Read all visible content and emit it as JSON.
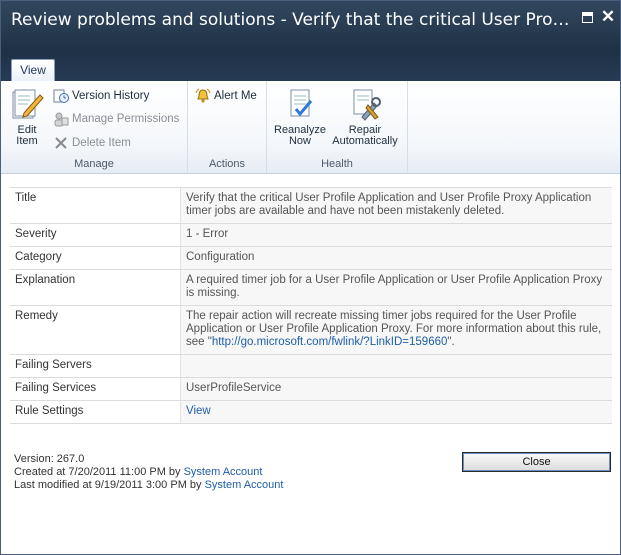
{
  "window": {
    "title": "Review problems and solutions - Verify that the critical User Profile Application and User Profile Proxy Application timer jobs are available and have not been mistakenly deleted."
  },
  "ribbon": {
    "tabs": [
      {
        "label": "View",
        "selected": true
      }
    ],
    "groups": {
      "manage": {
        "label": "Manage",
        "edit_item": "Edit Item",
        "version_history": "Version History",
        "manage_permissions": "Manage Permissions",
        "delete_item": "Delete Item"
      },
      "actions": {
        "label": "Actions",
        "alert_me": "Alert Me"
      },
      "health": {
        "label": "Health",
        "reanalyze_now": "Reanalyze Now",
        "repair_automatically": "Repair Automatically"
      }
    }
  },
  "properties": {
    "title": {
      "label": "Title",
      "value": "Verify that the critical User Profile Application and User Profile Proxy Application timer jobs are available and have not been mistakenly deleted."
    },
    "severity": {
      "label": "Severity",
      "value": "1 - Error"
    },
    "category": {
      "label": "Category",
      "value": "Configuration"
    },
    "explanation": {
      "label": "Explanation",
      "value": "A required timer job for a User Profile Application or User Profile Application Proxy is missing."
    },
    "remedy": {
      "label": "Remedy",
      "value_prefix": "The repair action will recreate missing timer jobs required for the User Profile Application or User Profile Application Proxy. For more information about this rule, see \"",
      "link": "http://go.microsoft.com/fwlink/?LinkID=159660",
      "value_suffix": "\"."
    },
    "failing_servers": {
      "label": "Failing Servers",
      "value": ""
    },
    "failing_services": {
      "label": "Failing Services",
      "value": "UserProfileService"
    },
    "rule_settings": {
      "label": "Rule Settings",
      "value": "View"
    }
  },
  "footer": {
    "version": "Version: 267.0",
    "created_prefix": "Created at 7/20/2011 11:00 PM by ",
    "created_by": "System Account",
    "modified_prefix": "Last modified at 9/19/2011 3:00 PM by ",
    "modified_by": "System Account",
    "close_label": "Close"
  },
  "colors": {
    "title_bar": "#1f3146",
    "link": "#1f5ea8"
  }
}
